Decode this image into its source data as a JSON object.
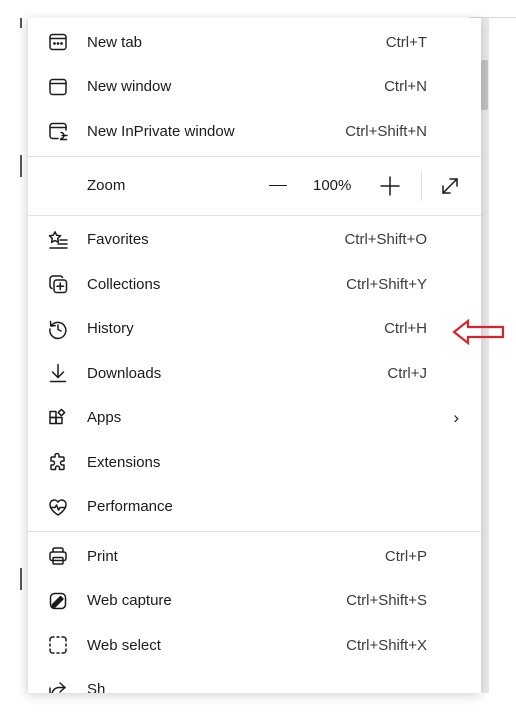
{
  "menu": {
    "section1": [
      {
        "label": "New tab",
        "shortcut": "Ctrl+T",
        "icon": "new-tab-icon"
      },
      {
        "label": "New window",
        "shortcut": "Ctrl+N",
        "icon": "new-window-icon"
      },
      {
        "label": "New InPrivate window",
        "shortcut": "Ctrl+Shift+N",
        "icon": "inprivate-icon"
      }
    ],
    "zoom": {
      "label": "Zoom",
      "value": "100%",
      "minus_icon": "zoom-out-icon",
      "plus_icon": "zoom-in-icon",
      "fullscreen_icon": "fullscreen-icon"
    },
    "section2": [
      {
        "label": "Favorites",
        "shortcut": "Ctrl+Shift+O",
        "icon": "favorites-icon"
      },
      {
        "label": "Collections",
        "shortcut": "Ctrl+Shift+Y",
        "icon": "collections-icon"
      },
      {
        "label": "History",
        "shortcut": "Ctrl+H",
        "icon": "history-icon"
      },
      {
        "label": "Downloads",
        "shortcut": "Ctrl+J",
        "icon": "downloads-icon"
      },
      {
        "label": "Apps",
        "shortcut": "",
        "icon": "apps-icon",
        "submenu": "›"
      },
      {
        "label": "Extensions",
        "shortcut": "",
        "icon": "extensions-icon"
      },
      {
        "label": "Performance",
        "shortcut": "",
        "icon": "performance-icon"
      }
    ],
    "section3": [
      {
        "label": "Print",
        "shortcut": "Ctrl+P",
        "icon": "print-icon"
      },
      {
        "label": "Web capture",
        "shortcut": "Ctrl+Shift+S",
        "icon": "web-capture-icon"
      },
      {
        "label": "Web select",
        "shortcut": "Ctrl+Shift+X",
        "icon": "web-select-icon"
      },
      {
        "label": "Sh",
        "shortcut": "",
        "icon": "share-icon"
      }
    ]
  },
  "annotation": {
    "arrow_color": "#d9232e",
    "arrow_target": "History"
  },
  "colors": {
    "text": "#1b1b1b",
    "divider": "#e1e1e1",
    "menu_background": "#ffffff"
  }
}
